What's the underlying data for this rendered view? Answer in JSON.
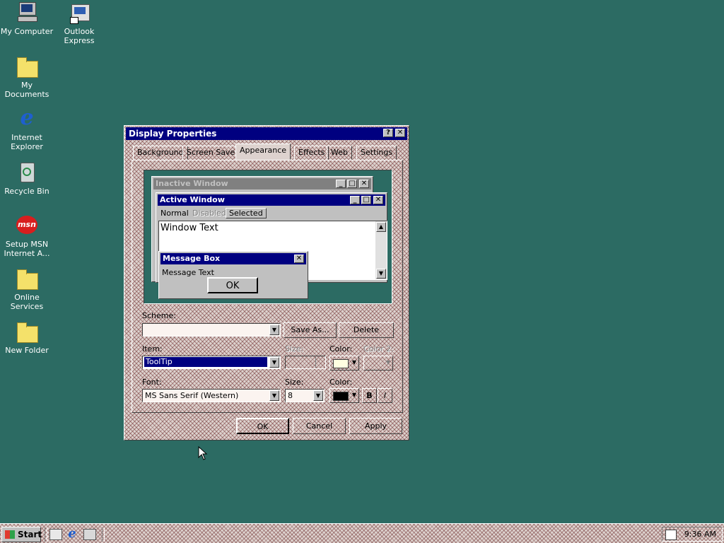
{
  "desktop": {
    "icons": [
      {
        "label": "My Computer"
      },
      {
        "label": "Outlook Express"
      },
      {
        "label": "My Documents"
      },
      {
        "label": "Internet Explorer"
      },
      {
        "label": "Recycle Bin"
      },
      {
        "label": "Setup MSN Internet A..."
      },
      {
        "label": "Online Services"
      },
      {
        "label": "New Folder"
      }
    ]
  },
  "dialog": {
    "title": "Display Properties",
    "help_glyph": "?",
    "close_glyph": "✕",
    "tabs": [
      "Background",
      "Screen Saver",
      "Appearance",
      "Effects",
      "Web",
      "Settings"
    ],
    "active_tab": "Appearance",
    "preview": {
      "inactive_title": "Inactive Window",
      "active_title": "Active Window",
      "menu": [
        "Normal",
        "Disabled",
        "Selected"
      ],
      "window_text": "Window Text",
      "msgbox_title": "Message Box",
      "msgbox_text": "Message Text",
      "msgbox_ok": "OK"
    },
    "scheme_label": "Scheme:",
    "scheme_value": "",
    "save_as_label": "Save As...",
    "delete_label": "Delete",
    "item_label": "Item:",
    "item_value": "ToolTip",
    "item_size_label": "Size:",
    "item_color_label": "Color:",
    "item_color2_label": "Color 2:",
    "font_label": "Font:",
    "font_value": "MS Sans Serif (Western)",
    "font_size_label": "Size:",
    "font_size_value": "8",
    "font_color_label": "Color:",
    "bold_label": "B",
    "italic_label": "I",
    "ok_label": "OK",
    "cancel_label": "Cancel",
    "apply_label": "Apply",
    "colors": {
      "title_active": "#000080",
      "title_inactive": "#808080",
      "tooltip_color": "#ffffe1",
      "font_color": "#000000"
    }
  },
  "taskbar": {
    "start_label": "Start",
    "clock": "9:36 AM"
  }
}
